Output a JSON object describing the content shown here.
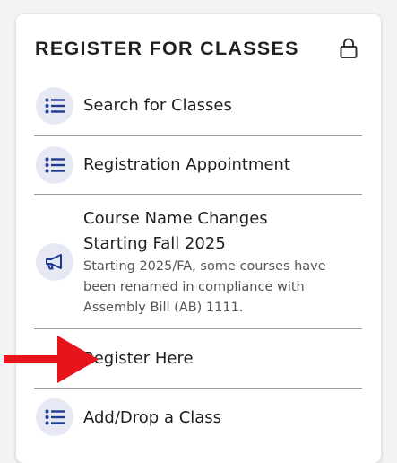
{
  "card": {
    "title": "REGISTER FOR CLASSES",
    "lock_icon": "lock-icon"
  },
  "items": [
    {
      "label": "Search for Classes",
      "icon": "list-icon"
    },
    {
      "label": "Registration Appointment",
      "icon": "list-icon"
    },
    {
      "label": "Course Name Changes Starting Fall 2025",
      "description": "Starting 2025/FA, some courses have been renamed in compliance with Assembly Bill (AB) 1111.",
      "icon": "megaphone-icon"
    },
    {
      "label": "Register Here",
      "icon": "none"
    },
    {
      "label": "Add/Drop a Class",
      "icon": "list-icon"
    }
  ],
  "annotation": {
    "arrow_color": "#e8141b",
    "icon": "red-arrow-icon"
  },
  "colors": {
    "icon_blue": "#1f3a8f",
    "icon_bg": "#e6e8f4"
  }
}
